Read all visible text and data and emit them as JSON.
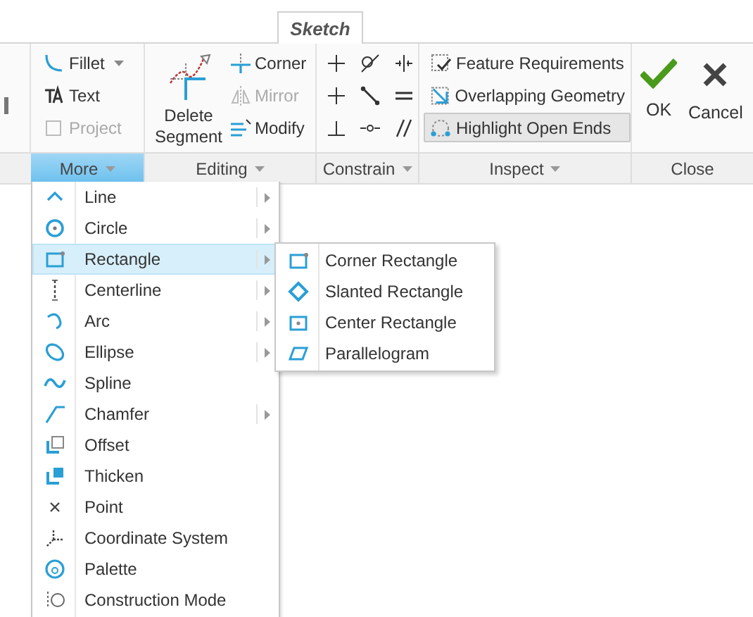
{
  "tabs": [
    {
      "label": "Sketch",
      "selected": true
    }
  ],
  "groups": [
    {
      "label": "More",
      "selected": true,
      "dropdown": true
    },
    {
      "label": "Editing",
      "selected": false,
      "dropdown": true
    },
    {
      "label": "Constrain",
      "selected": false,
      "dropdown": true
    },
    {
      "label": "Inspect",
      "selected": false,
      "dropdown": true
    },
    {
      "label": "Close",
      "selected": false,
      "dropdown": false
    }
  ],
  "more_buttons": [
    {
      "label": "Fillet",
      "dropdown": true,
      "disabled": false
    },
    {
      "label": "Text",
      "dropdown": false,
      "disabled": false
    },
    {
      "label": "Project",
      "dropdown": false,
      "disabled": true
    }
  ],
  "delete_segment": {
    "label": "Delete Segment"
  },
  "editing_buttons": [
    {
      "label": "Corner",
      "disabled": false
    },
    {
      "label": "Mirror",
      "disabled": true
    },
    {
      "label": "Modify",
      "disabled": false
    }
  ],
  "inspect_buttons": [
    {
      "label": "Feature Requirements",
      "selected": false
    },
    {
      "label": "Overlapping Geometry",
      "selected": false
    },
    {
      "label": "Highlight Open Ends",
      "selected": true
    }
  ],
  "close_buttons": [
    "OK",
    "Cancel"
  ],
  "menu": [
    {
      "label": "Line",
      "submenu": true,
      "selected": false
    },
    {
      "label": "Circle",
      "submenu": true,
      "selected": false
    },
    {
      "label": "Rectangle",
      "submenu": true,
      "selected": true
    },
    {
      "label": "Centerline",
      "submenu": true,
      "selected": false
    },
    {
      "label": "Arc",
      "submenu": true,
      "selected": false
    },
    {
      "label": "Ellipse",
      "submenu": true,
      "selected": false
    },
    {
      "label": "Spline",
      "submenu": false,
      "selected": false
    },
    {
      "label": "Chamfer",
      "submenu": true,
      "selected": false
    },
    {
      "label": "Offset",
      "submenu": false,
      "selected": false
    },
    {
      "label": "Thicken",
      "submenu": false,
      "selected": false
    },
    {
      "label": "Point",
      "submenu": false,
      "selected": false
    },
    {
      "label": "Coordinate System",
      "submenu": false,
      "selected": false
    },
    {
      "label": "Palette",
      "submenu": false,
      "selected": false
    },
    {
      "label": "Construction Mode",
      "submenu": false,
      "selected": false
    }
  ],
  "submenu": [
    {
      "label": "Corner Rectangle"
    },
    {
      "label": "Slanted Rectangle"
    },
    {
      "label": "Center Rectangle"
    },
    {
      "label": "Parallelogram"
    }
  ]
}
